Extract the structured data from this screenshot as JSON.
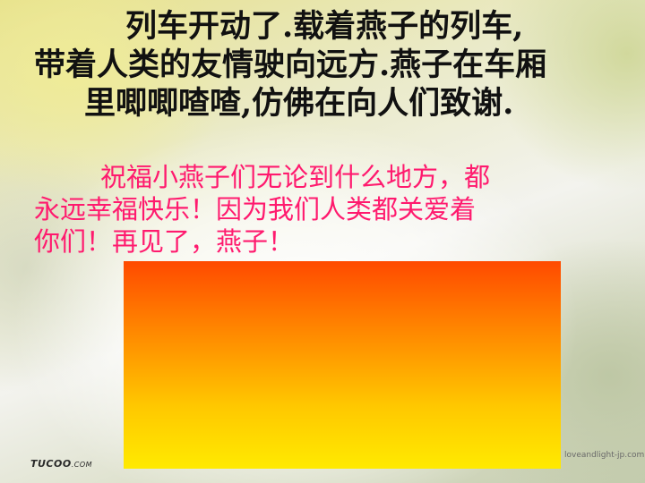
{
  "slide": {
    "main_text_lines": [
      "列车开动了.载着燕子的列车,",
      "带着人类的友情驶向远方.燕子在车厢",
      "里唧唧喳喳,仿佛在向人们致谢."
    ],
    "pink_text_lines": [
      "祝福小燕子们无论到什么地方，都",
      "永远幸福快乐！因为我们人类都关爱着",
      "你们！再见了，燕子！"
    ],
    "watermark_left_main": "TUCOO",
    "watermark_left_suffix": ".COM",
    "watermark_right": "loveandlight-jp.com"
  },
  "colors": {
    "main_text": "#111111",
    "pink_text": "#ff1a6e",
    "box_top": "#ff4a00",
    "box_bottom": "#ffea00"
  }
}
